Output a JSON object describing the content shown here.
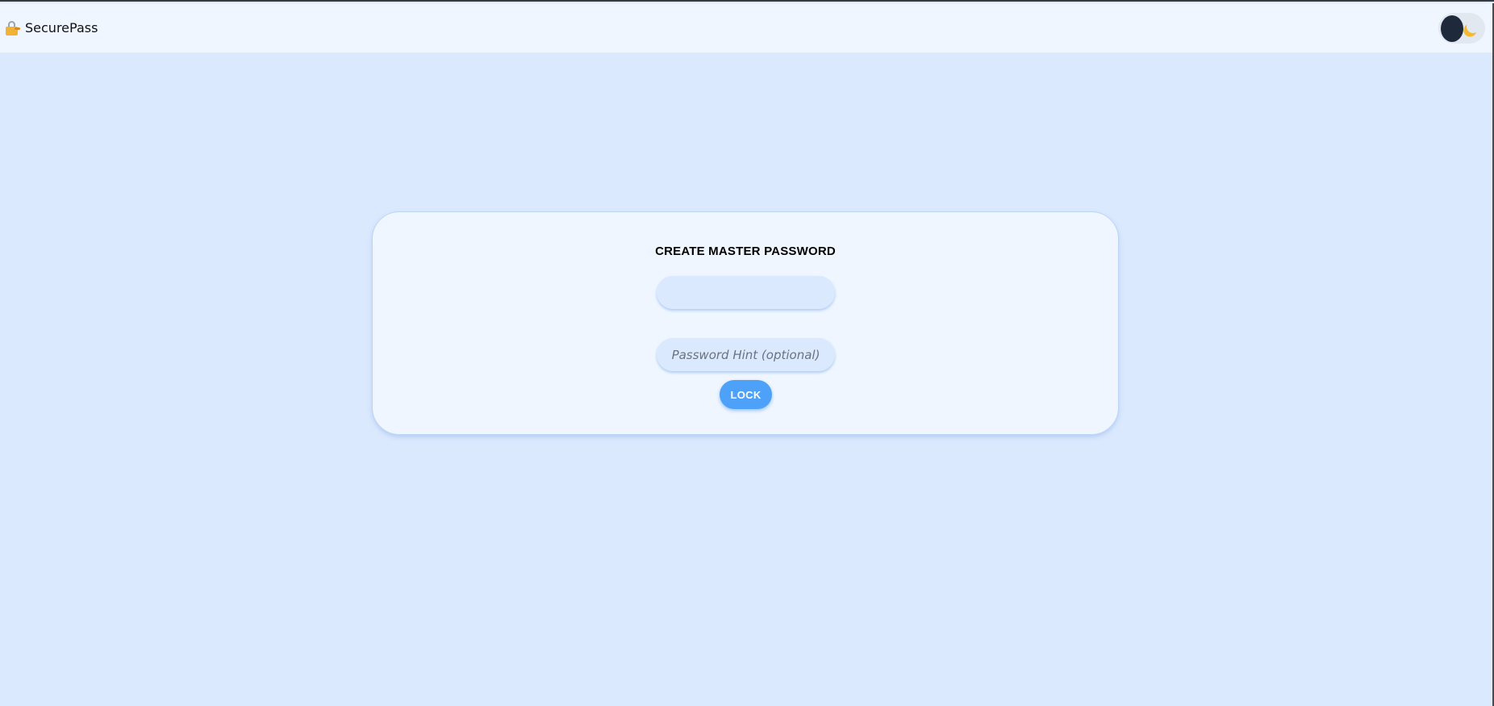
{
  "app": {
    "brand_name": "SecurePass",
    "brand_icon": "lock-with-key-icon"
  },
  "header": {
    "theme_toggle": {
      "icon": "moon-icon",
      "state": "light"
    }
  },
  "master_password_form": {
    "title": "CREATE MASTER PASSWORD",
    "password_field": {
      "value": "",
      "placeholder": "",
      "type": "password"
    },
    "hint_field": {
      "value": "",
      "placeholder": "Password Hint (optional)"
    },
    "submit_label": "LOCK"
  },
  "colors": {
    "page_background": "#dbe9fe",
    "header_background": "#eff6ff",
    "card_background": "#eff6ff",
    "accent": "#4ea1f8",
    "toggle_knob": "#1e293b",
    "moon": "#f5b82e"
  }
}
